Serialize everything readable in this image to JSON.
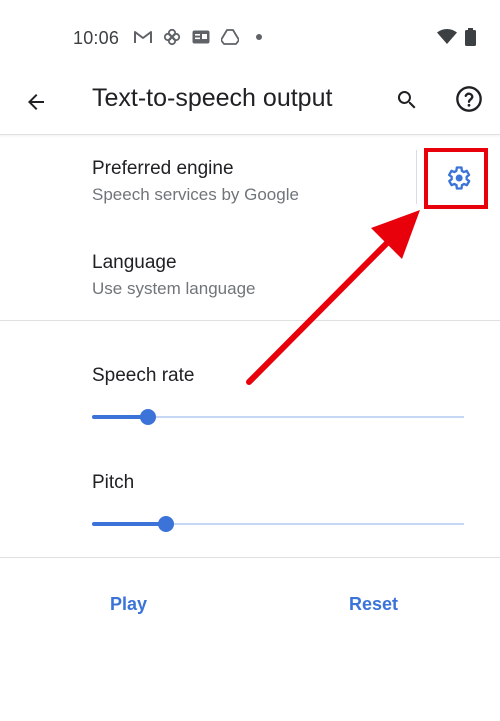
{
  "status_bar": {
    "time": "10:06",
    "left_icons": [
      "gmail-icon",
      "pinwheel-icon",
      "news-icon",
      "drive-icon",
      "dot-icon"
    ],
    "right_icons": [
      "wifi-icon",
      "battery-icon"
    ]
  },
  "app_bar": {
    "title": "Text-to-speech output",
    "back_icon": "arrow-back-icon",
    "search_icon": "search-icon",
    "help_icon": "help-icon"
  },
  "preferences": {
    "engine": {
      "title": "Preferred engine",
      "subtitle": "Speech services by Google",
      "settings_icon": "gear-icon"
    },
    "language": {
      "title": "Language",
      "subtitle": "Use system language"
    }
  },
  "sliders": {
    "speech_rate": {
      "label": "Speech rate",
      "value_fraction": 0.15
    },
    "pitch": {
      "label": "Pitch",
      "value_fraction": 0.2
    }
  },
  "actions": {
    "play_label": "Play",
    "reset_label": "Reset"
  },
  "colors": {
    "accent": "#3b73d9",
    "annotation": "#e8000b"
  }
}
